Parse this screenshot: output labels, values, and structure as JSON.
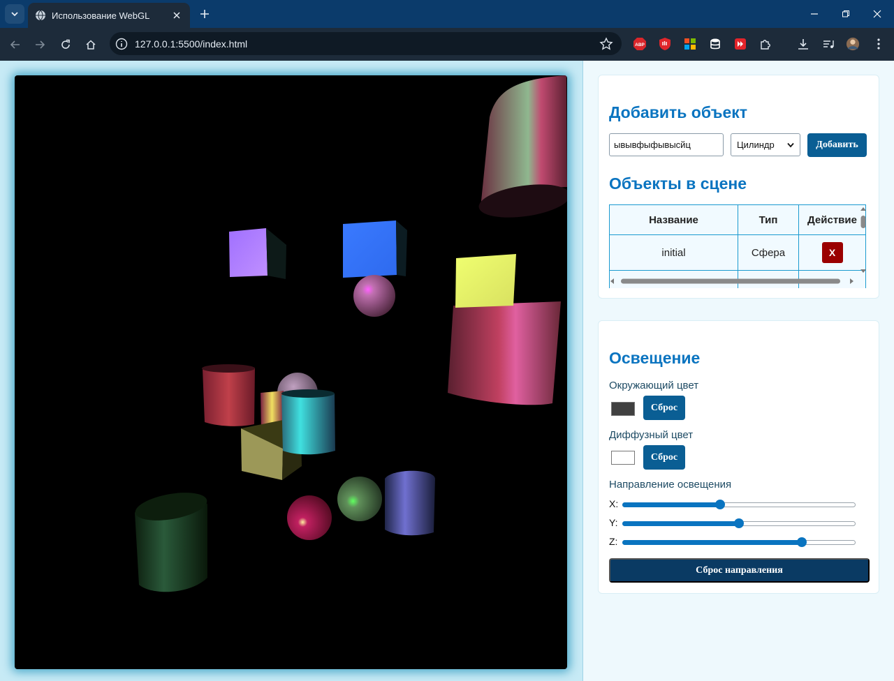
{
  "browser": {
    "tab_title": "Использование WebGL",
    "url": "127.0.0.1:5500/index.html"
  },
  "add_object": {
    "heading": "Добавить объект",
    "name_value": "ывывфыфывысйц",
    "type_selected": "Цилиндр",
    "add_label": "Добавить"
  },
  "scene_objects": {
    "heading": "Объекты в сцене",
    "columns": [
      "Название",
      "Тип",
      "Действие"
    ],
    "rows": [
      {
        "name": "initial",
        "type": "Сфера",
        "action": "X"
      }
    ]
  },
  "lighting": {
    "heading": "Освещение",
    "ambient_label": "Окружающий цвет",
    "ambient_color": "#404040",
    "diffuse_label": "Диффузный цвет",
    "diffuse_color": "#ffffff",
    "reset_label": "Сброс",
    "direction_label": "Направление освещения",
    "x_label": "X:",
    "y_label": "Y:",
    "z_label": "Z:",
    "x_value": 0.42,
    "y_value": 0.5,
    "z_value": 0.77,
    "reset_direction_label": "Сброс направления"
  },
  "colors": {
    "accent": "#0a74c0",
    "button": "#0a5e94",
    "danger": "#9b0000",
    "chrome": "#0b3b6b"
  }
}
